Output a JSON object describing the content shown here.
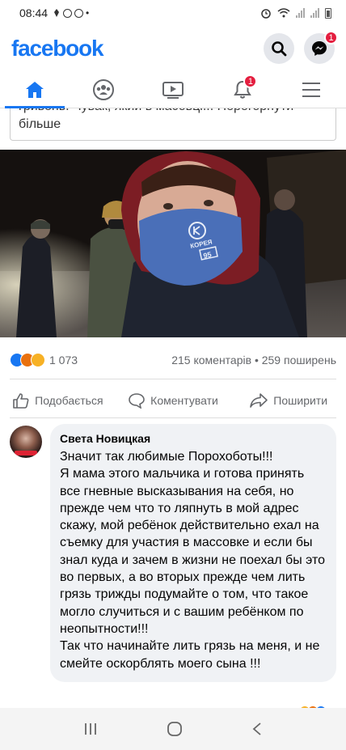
{
  "status_bar": {
    "time": "08:44",
    "dot": "•"
  },
  "header": {
    "logo": "facebook",
    "messenger_badge": "1"
  },
  "nav": {
    "notifications_badge": "1"
  },
  "post": {
    "text_cut": "гривень. Чувак, який в масовці... Перегорнути",
    "text_more": "більше",
    "reaction_count": "1 073",
    "stats": "215 коментарів • 259 поширень"
  },
  "actions": {
    "like": "Подобається",
    "comment": "Коментувати",
    "share": "Поширити"
  },
  "comment": {
    "author": "Света Новицкая",
    "text": "Значит так любимые Порохоботы!!!\nЯ мама этого мальчика и готова принять все гневные высказывания на себя, но прежде чем что то ляпнуть в мой адрес скажу, мой ребёнок действительно ехал на съемку для участия в массовке и если бы знал куда и зачем в жизни не поехал бы это во первых, а во вторых прежде чем лить грязь трижды подумайте о том, что такое могло случиться и с вашим ребёнком по неопытности!!!\nТак что начинайте лить грязь на меня, и не смейте оскорблять моего сына !!!"
  },
  "mask_text": {
    "line1": "КОРЕЯ",
    "line2": "95"
  },
  "colors": {
    "brand": "#1877f2",
    "badge": "#e41e3f",
    "mask": "#4a6fb8"
  }
}
